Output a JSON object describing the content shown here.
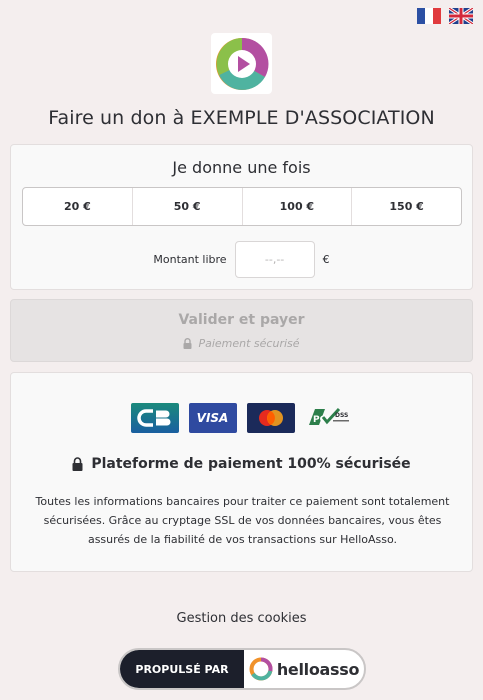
{
  "flags": {
    "fr_title": "Français",
    "en_title": "English"
  },
  "title": "Faire un don à EXEMPLE D'ASSOCIATION",
  "donation": {
    "title": "Je donne une fois",
    "amounts": [
      "20 €",
      "50 €",
      "100 €",
      "150 €"
    ],
    "free_label": "Montant libre",
    "free_placeholder": "--,--",
    "currency": "€"
  },
  "pay": {
    "label": "Valider et payer",
    "sub": "Paiement sécurisé"
  },
  "secure": {
    "logos": [
      "CB",
      "VISA",
      "MasterCard",
      "PCI DSS"
    ],
    "title": "Plateforme de paiement 100% sécurisée",
    "text": "Toutes les informations bancaires pour traiter ce paiement sont totalement sécurisées. Grâce au cryptage SSL de vos données bancaires, vous êtes assurés de la fiabilité de vos transactions sur HelloAsso."
  },
  "cookies": "Gestion des cookies",
  "powered": {
    "label": "PROPULSÉ PAR",
    "brand": "helloasso"
  },
  "colors": {
    "background": "#f4eeee",
    "text": "#2e2f34",
    "disabled": "#aaa8a8",
    "dark": "#1c1f2b"
  }
}
